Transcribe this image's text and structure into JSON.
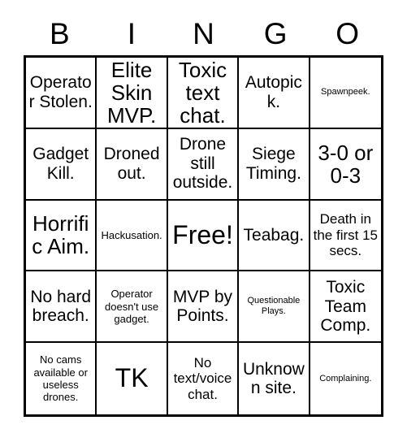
{
  "card": {
    "title": "BINGO",
    "columns": [
      "B",
      "I",
      "N",
      "G",
      "O"
    ],
    "free_space_index": 12,
    "colors": {
      "background": "#ffffff",
      "border": "#000000",
      "text": "#000000"
    },
    "grid": {
      "rows": 5,
      "cols": 5
    },
    "cells": [
      {
        "text": "Operator Stolen.",
        "size": "md"
      },
      {
        "text": "Elite Skin MVP.",
        "size": "lg"
      },
      {
        "text": "Toxic text chat.",
        "size": "lg"
      },
      {
        "text": "Autopick.",
        "size": "md"
      },
      {
        "text": "Spawnpeek.",
        "size": "xxs"
      },
      {
        "text": "Gadget Kill.",
        "size": "md"
      },
      {
        "text": "Droned out.",
        "size": "md"
      },
      {
        "text": "Drone still outside.",
        "size": "md"
      },
      {
        "text": "Siege Timing.",
        "size": "md"
      },
      {
        "text": "3-0 or 0-3",
        "size": "lg"
      },
      {
        "text": "Horrific Aim.",
        "size": "lg"
      },
      {
        "text": "Hackusation.",
        "size": "xs"
      },
      {
        "text": "Free!",
        "size": "xl"
      },
      {
        "text": "Teabag.",
        "size": "md"
      },
      {
        "text": "Death in the first 15 secs.",
        "size": "sm"
      },
      {
        "text": "No hard breach.",
        "size": "md"
      },
      {
        "text": "Operator doesn't use gadget.",
        "size": "xs"
      },
      {
        "text": "MVP by Points.",
        "size": "md"
      },
      {
        "text": "Questionable Plays.",
        "size": "xxs"
      },
      {
        "text": "Toxic Team Comp.",
        "size": "md"
      },
      {
        "text": "No cams available or useless drones.",
        "size": "xs"
      },
      {
        "text": "TK",
        "size": "xl"
      },
      {
        "text": "No text/voice chat.",
        "size": "sm"
      },
      {
        "text": "Unknown site.",
        "size": "md"
      },
      {
        "text": "Complaining.",
        "size": "xxs"
      }
    ]
  }
}
